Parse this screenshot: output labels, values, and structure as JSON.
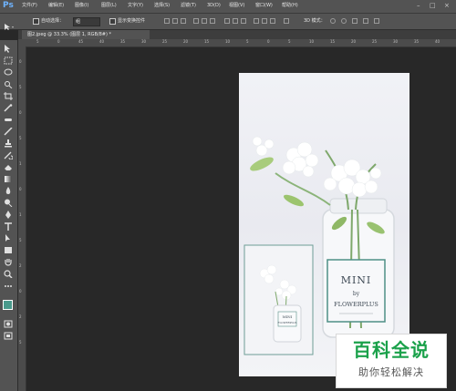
{
  "app": {
    "logo": "Ps"
  },
  "menu": {
    "items": [
      "文件(F)",
      "编辑(E)",
      "图像(I)",
      "图层(L)",
      "文字(Y)",
      "选择(S)",
      "滤镜(T)",
      "3D(D)",
      "视图(V)",
      "窗口(W)",
      "帮助(H)"
    ],
    "window_controls": [
      "–",
      "□",
      "×"
    ]
  },
  "options": {
    "auto_select_label": "自动选择：",
    "auto_select_value": "组",
    "show_transform_label": "显示变换控件",
    "mode_3d_label": "3D 模式："
  },
  "document": {
    "tab_title": "图2.jpeg @ 33.3% (图层 1, RGB/8#) *"
  },
  "rulers": {
    "h_ticks": [
      "5",
      "0",
      "45",
      "40",
      "35",
      "30",
      "25",
      "20",
      "15",
      "10",
      "5",
      "0",
      "5",
      "10",
      "15",
      "20",
      "25",
      "30",
      "35",
      "40"
    ],
    "v_ticks": [
      "0",
      "5",
      "0",
      "5",
      "1",
      "0",
      "1",
      "5",
      "2",
      "0",
      "2",
      "5"
    ]
  },
  "artwork": {
    "label_line1": "MINI",
    "label_line2": "by",
    "label_line3": "FLOWERPLUS",
    "small_label_line1": "MINI",
    "small_label_line2": "FLOWERPLUS"
  },
  "watermark": {
    "title": "百科全说",
    "subtitle": "助你轻松解决"
  },
  "colors": {
    "foreground": "#4a9a8c",
    "background": "#ffffff"
  }
}
